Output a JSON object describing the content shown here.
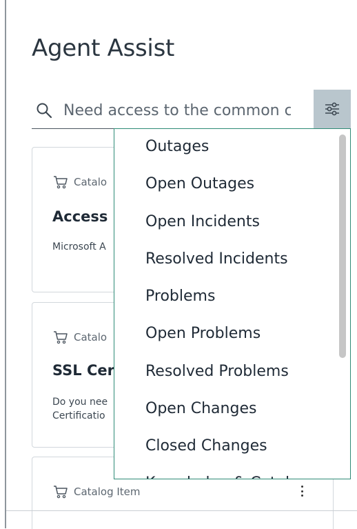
{
  "header": {
    "title": "Agent Assist"
  },
  "search": {
    "placeholder": "Need access to the common c"
  },
  "cards": [
    {
      "type": "Catalog Item",
      "type_visible": "Catalo",
      "title": "Access",
      "description": "Microsoft A"
    },
    {
      "type": "Catalog Item",
      "type_visible": "Catalo",
      "title": "SSL Cer",
      "description_lines": [
        "Do you nee",
        "Certificatio"
      ]
    },
    {
      "type": "Catalog Item"
    }
  ],
  "filter_menu": {
    "items": [
      "Outages",
      "Open Outages",
      "Open Incidents",
      "Resolved Incidents",
      "Problems",
      "Open Problems",
      "Resolved Problems",
      "Open Changes",
      "Closed Changes",
      "Knowledge & Catalog"
    ]
  },
  "colors": {
    "accent_border": "#2d8a76",
    "filter_button_bg": "#b9c6cd"
  },
  "icons": {
    "search": "search-icon",
    "filter": "sliders-icon",
    "cart": "cart-icon",
    "more": "more-vertical-icon"
  }
}
